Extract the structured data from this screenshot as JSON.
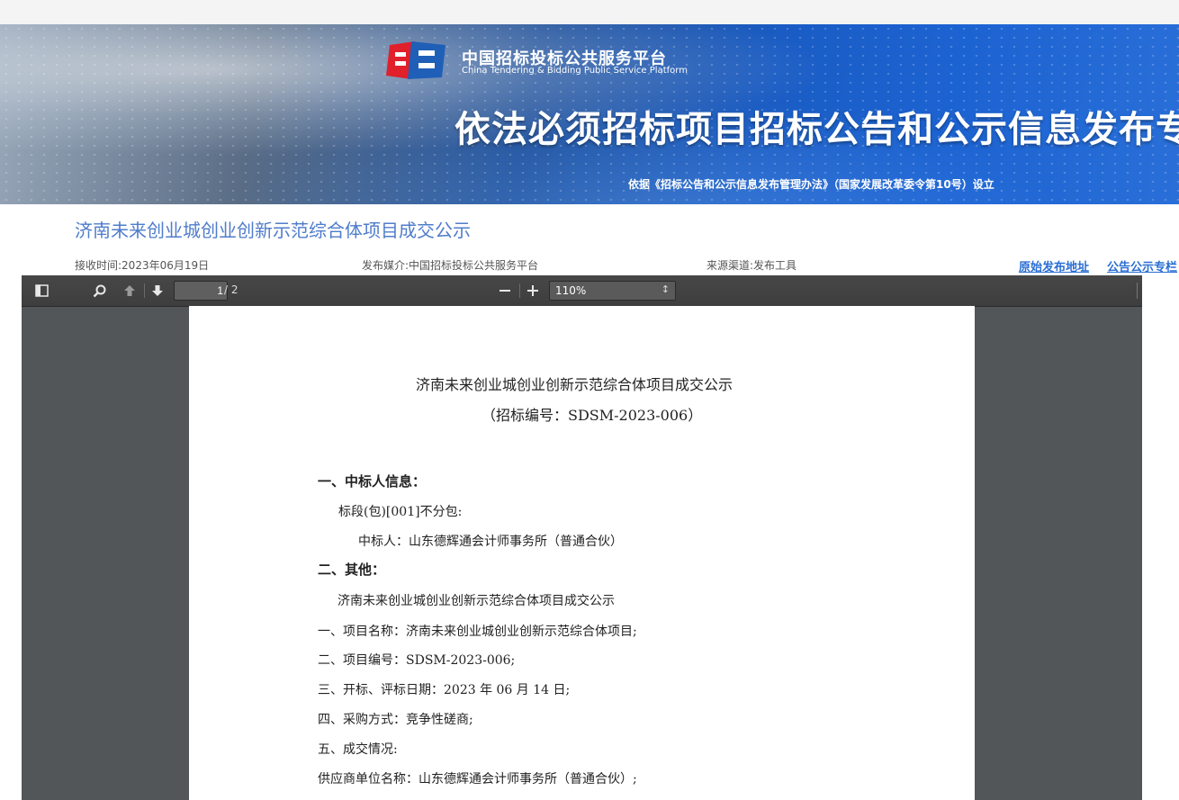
{
  "banner": {
    "logo_cn": "中国招标投标公共服务平台",
    "logo_en": "China Tendering & Bidding Public Service Platform",
    "title": "依法必须招标项目招标公告和公示信息发布专栏",
    "subtitle": "依据《招标公告和公示信息发布管理办法》（国家发展改革委令第10号）设立"
  },
  "notice": {
    "title": "济南未来创业城创业创新示范综合体项目成交公示",
    "received": "接收时间:2023年06月19日",
    "media": "发布媒介:中国招标投标公共服务平台",
    "source": "来源渠道:发布工具",
    "link_original": "原始发布地址",
    "link_column": "公告公示专栏"
  },
  "viewer": {
    "page_current": "1",
    "page_total": "/ 2",
    "zoom": "110%"
  },
  "document": {
    "title": "济南未来创业城创业创新示范综合体项目成交公示",
    "code": "（招标编号：SDSM-2023-006）",
    "section1": "一、中标人信息：",
    "lot": "标段(包)[001]不分包:",
    "winner": "中标人：山东德辉通会计师事务所（普通合伙）",
    "section2": "二、其他：",
    "sub_title": "济南未来创业城创业创新示范综合体项目成交公示",
    "item1": "一、项目名称：济南未来创业城创业创新示范综合体项目;",
    "item2": "二、项目编号：SDSM-2023-006;",
    "item3": "三、开标、评标日期：2023 年 06 月 14 日;",
    "item4": "四、采购方式：竞争性磋商;",
    "item5": "五、成交情况:",
    "item6": "供应商单位名称：山东德辉通会计师事务所（普通合伙）;"
  },
  "colors": {
    "notice_title": "#4f7ccb",
    "link": "#2a6ed3",
    "viewer_bg": "#525659",
    "toolbar": "#474747",
    "logo_red": "#e0202a",
    "logo_blue": "#1f5fb8"
  },
  "icons": [
    "sidebar-toggle-icon",
    "search-icon",
    "arrow-up-icon",
    "arrow-down-icon",
    "zoom-out-icon",
    "zoom-in-icon",
    "chevron-updown-icon"
  ]
}
